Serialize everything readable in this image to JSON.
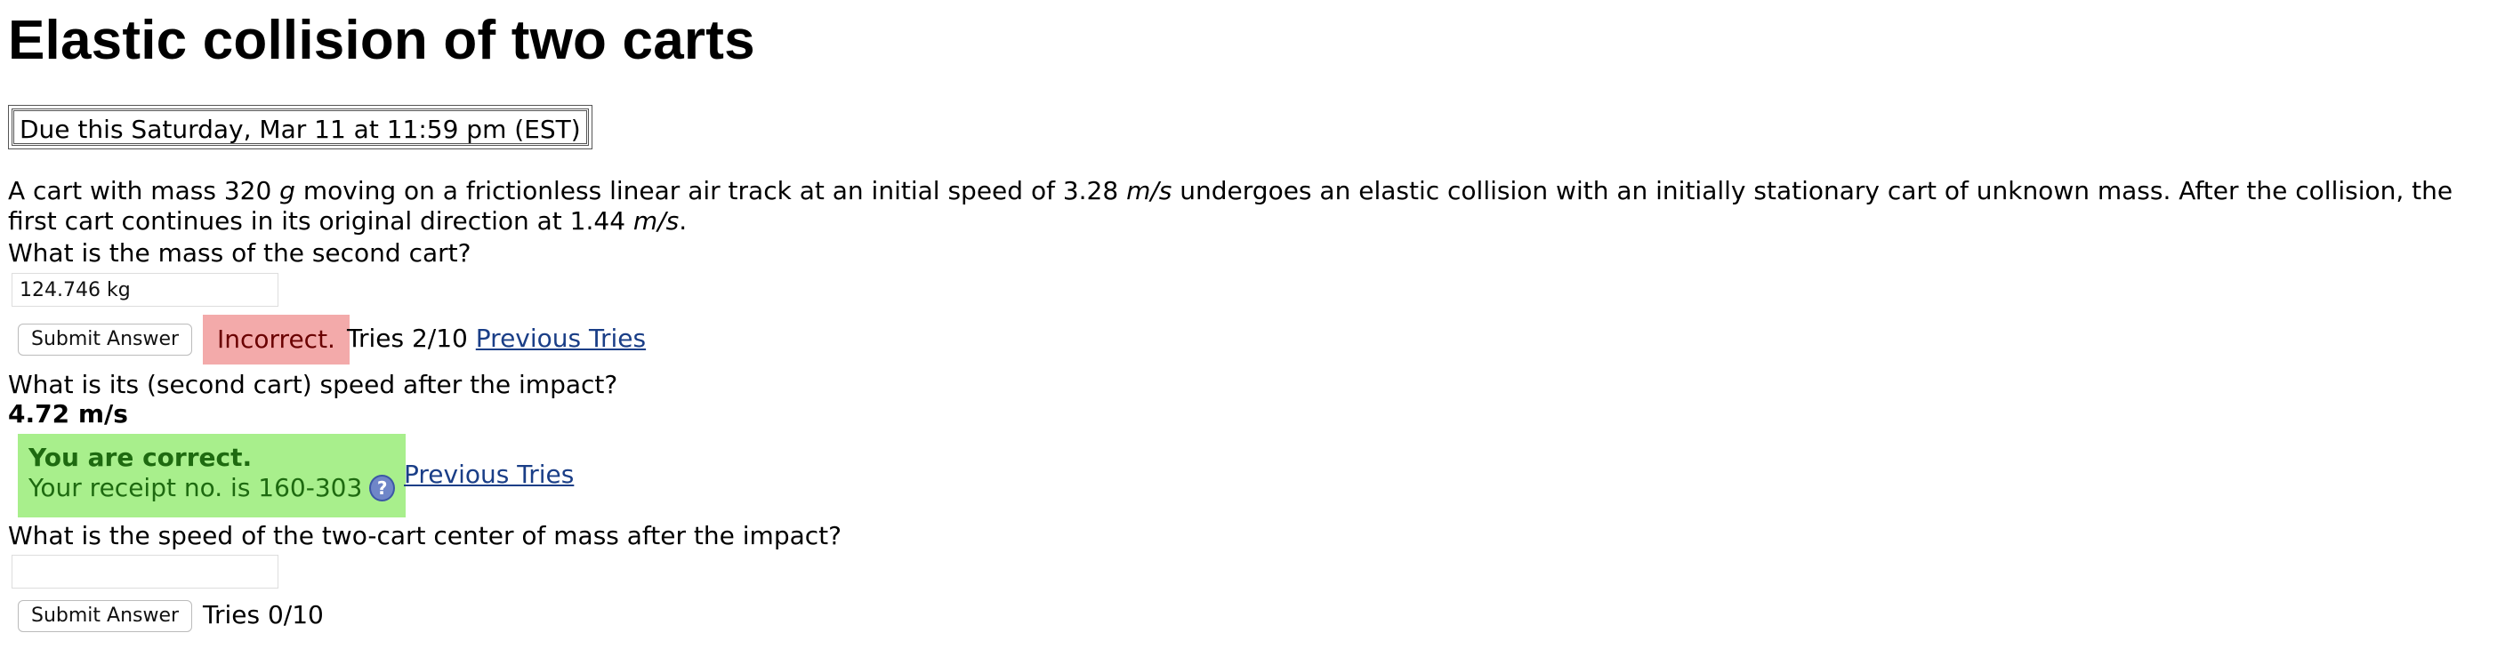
{
  "title": "Elastic collision of two carts",
  "due": "Due this Saturday, Mar 11 at 11:59 pm (EST)",
  "problem": {
    "p1": "A cart with mass 320 ",
    "unit_g": "g",
    "p2": " moving on a frictionless linear air track at an initial speed of 3.28 ",
    "unit_ms1": "m/s",
    "p3": " undergoes an elastic collision with an initially stationary cart of unknown mass. After the collision, the first cart continues in its original direction at 1.44 ",
    "unit_ms2": "m/s",
    "p4": "."
  },
  "parts": [
    {
      "question": "What is the mass of the second cart?",
      "input_value": "124.746 kg",
      "submit_label": "Submit Answer",
      "status": "Incorrect.",
      "tries": "Tries 2/10",
      "previous_tries": "Previous Tries"
    },
    {
      "question": "What is its (second cart) speed after the impact?",
      "answer": "4.72 m/s",
      "correct_title": "You are correct.",
      "receipt": "Your receipt no. is 160-303",
      "previous_tries": "Previous Tries"
    },
    {
      "question": "What is the speed of the two-cart center of mass after the impact?",
      "input_value": "",
      "submit_label": "Submit Answer",
      "tries": "Tries 0/10"
    }
  ],
  "colors": {
    "incorrect_bg": "#f3aaaa",
    "correct_bg": "#a8ef8c",
    "correct_text": "#1e6a10",
    "link": "#1a3e87"
  },
  "icons": {
    "help": "question-circle-icon"
  }
}
